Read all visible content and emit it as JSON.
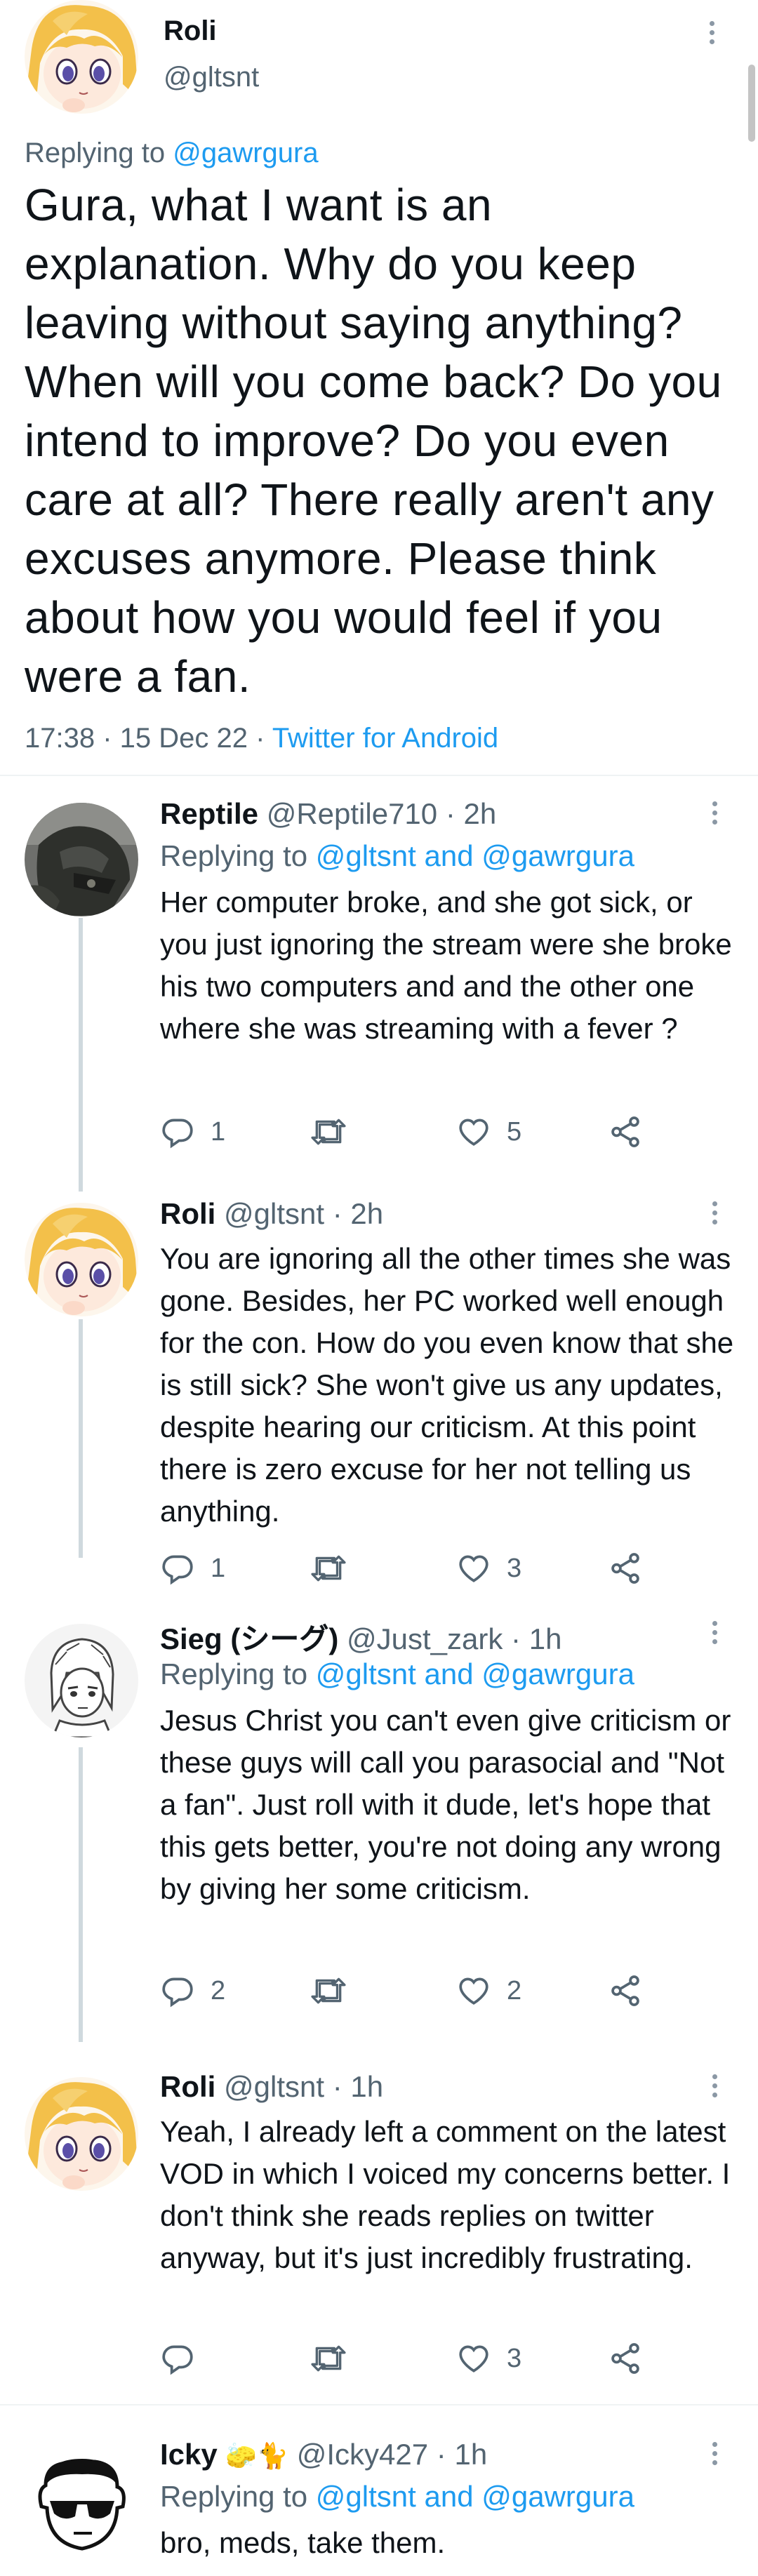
{
  "main_tweet": {
    "name": "Roli",
    "handle": "@gltsnt",
    "replying_prefix": "Replying to ",
    "replying_to": "@gawrgura",
    "text": "Gura, what I want is an explanation. Why do you keep leaving without saying anything? When will you come back? Do you intend to improve? Do you even care at all? There really aren't any excuses anymore. Please think about how you would feel if you were a fan.",
    "time": "17:38 · 15 Dec 22 · ",
    "source": "Twitter for Android"
  },
  "replies": [
    {
      "name": "Reptile",
      "handle": "@Reptile710 · 2h",
      "replying_prefix": "Replying to ",
      "replying_to": "@gltsnt and @gawrgura",
      "text": "Her computer broke, and she got sick, or you just ignoring the stream were she broke his two computers and and the other one where she was streaming with a fever ?",
      "replies_count": "1",
      "retweets_count": "",
      "likes_count": "5"
    },
    {
      "name": "Roli",
      "handle": "@gltsnt · 2h",
      "replying_prefix": "",
      "replying_to": "",
      "text": "You are ignoring all the other times she was gone. Besides, her PC worked well enough for the con. How do you even know that she is still sick? She won't give us any updates, despite hearing our criticism. At this point there is zero excuse for her not telling us anything.",
      "replies_count": "1",
      "retweets_count": "",
      "likes_count": "3"
    },
    {
      "name": "Sieg (シーグ)",
      "handle": "@Just_zark · 1h",
      "replying_prefix": "Replying to ",
      "replying_to": "@gltsnt and @gawrgura",
      "text": "Jesus Christ you can't even give criticism or these guys will call you parasocial and \"Not a fan\". Just roll with it dude, let's hope that this gets better, you're not doing any wrong by giving her some criticism.",
      "replies_count": "2",
      "retweets_count": "",
      "likes_count": "2"
    },
    {
      "name": "Roli",
      "handle": "@gltsnt · 1h",
      "replying_prefix": "",
      "replying_to": "",
      "text": "Yeah, I already left a comment on the latest VOD in which I voiced my concerns better. I don't think she reads replies on twitter anyway, but it's just incredibly frustrating.",
      "replies_count": "",
      "retweets_count": "",
      "likes_count": "3"
    },
    {
      "name": "Icky",
      "name_emoji": "🧽🐈",
      "handle": "@Icky427 · 1h",
      "replying_prefix": "Replying to ",
      "replying_to": "@gltsnt and @gawrgura",
      "text": "bro, meds, take them."
    }
  ],
  "icons": [
    "more-icon",
    "reply-icon",
    "retweet-icon",
    "like-icon",
    "share-icon"
  ],
  "colors": {
    "link": "#1d9bf0",
    "secondary": "#536471",
    "text": "#0f1419",
    "thread": "#cfd9de"
  }
}
